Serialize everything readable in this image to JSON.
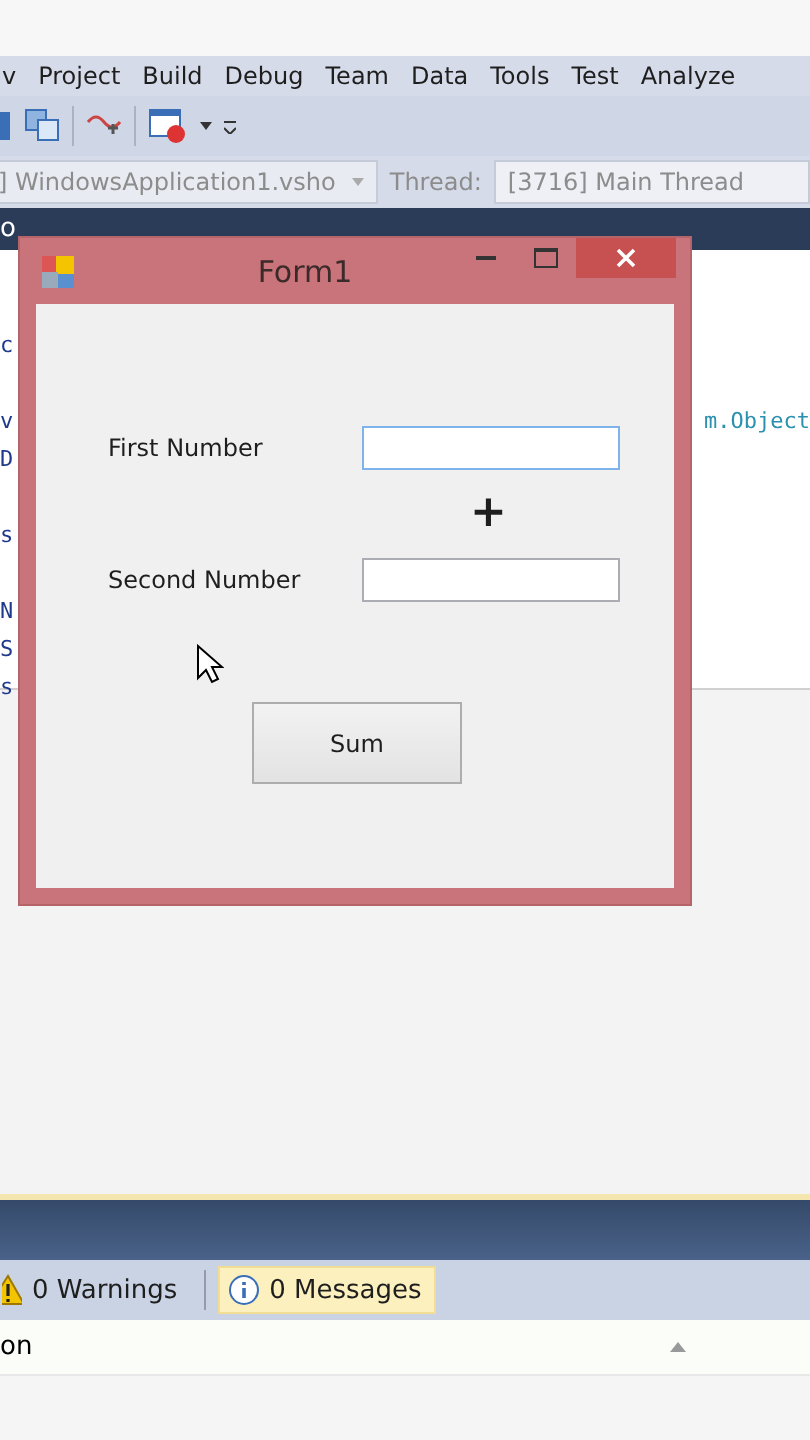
{
  "menu_bar": {
    "items": [
      "v",
      "Project",
      "Build",
      "Debug",
      "Team",
      "Data",
      "Tools",
      "Test",
      "Analyze"
    ]
  },
  "debug_bar": {
    "process": "] WindowsApplication1.vsho",
    "thread_label": "Thread:",
    "thread": "[3716] Main Thread"
  },
  "document_tab": {
    "label": "o"
  },
  "editor": {
    "lines": [
      {
        "kind": "code",
        "left": "c"
      },
      {
        "kind": "blank"
      },
      {
        "kind": "code",
        "left": "v",
        "right": "m.Object"
      },
      {
        "kind": "code",
        "left": "D"
      },
      {
        "kind": "blank"
      },
      {
        "kind": "code",
        "left": "s"
      },
      {
        "kind": "blank"
      },
      {
        "kind": "code",
        "left": "N"
      },
      {
        "kind": "code",
        "left": "S"
      },
      {
        "kind": "code",
        "left": "s"
      }
    ]
  },
  "form": {
    "title": "Form1",
    "fields": [
      {
        "label": "First Number",
        "focused": true
      },
      {
        "label": "Second Number",
        "focused": false
      }
    ],
    "operator": "+",
    "button": "Sum"
  },
  "error_list": {
    "filters": [
      {
        "kind": "warning",
        "label": "0 Warnings",
        "selected": false
      },
      {
        "kind": "info",
        "label": "0 Messages",
        "selected": true
      }
    ],
    "column": "on"
  }
}
